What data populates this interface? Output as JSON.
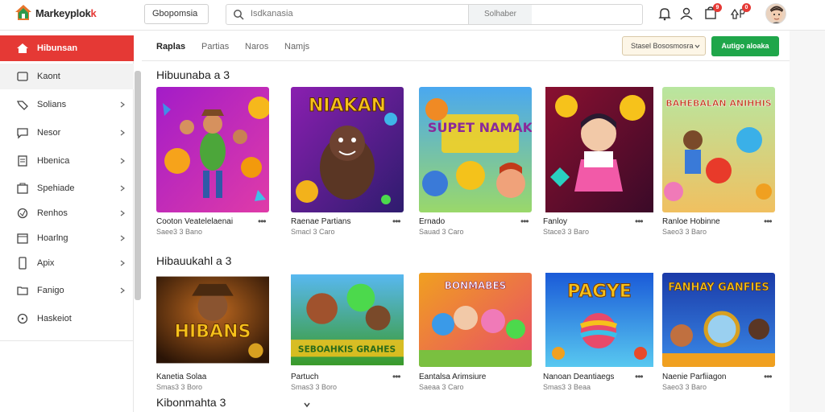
{
  "brand": {
    "name": "Markeyplok",
    "accent_suffix": "k",
    "accent_color": "#e53935"
  },
  "topbar": {
    "category_select": "Gbopomsia",
    "search": {
      "placeholder": "Isdkanasia",
      "button": "Solhaber"
    },
    "icons": [
      "bell-icon",
      "user-icon",
      "cart-icon",
      "notifications-icon"
    ],
    "badges": {
      "cart": "9",
      "notifications": "0"
    }
  },
  "sidebar": {
    "items": [
      {
        "label": "Hibunsan",
        "icon": "home-icon",
        "chevron": false
      },
      {
        "label": "Kaont",
        "icon": "clock-icon",
        "chevron": false
      },
      {
        "label": "Solians",
        "icon": "tag-icon",
        "chevron": true
      },
      {
        "label": "Nesor",
        "icon": "chat-icon",
        "chevron": true
      },
      {
        "label": "Hbenica",
        "icon": "document-icon",
        "chevron": true
      },
      {
        "label": "Spehiade",
        "icon": "box-icon",
        "chevron": true
      },
      {
        "label": "Renhos",
        "icon": "tag-icon",
        "chevron": true
      },
      {
        "label": "Hoarlng",
        "icon": "calendar-icon",
        "chevron": true
      },
      {
        "label": "Apix",
        "icon": "phone-icon",
        "chevron": true
      },
      {
        "label": "Fanigo",
        "icon": "folder-icon",
        "chevron": true
      },
      {
        "label": "Haskeiot",
        "icon": "help-icon",
        "chevron": false
      }
    ]
  },
  "tabs": [
    "Raplas",
    "Partias",
    "Naros",
    "Namjs"
  ],
  "toolbar": {
    "sort_label": "Stasel Bososmosra",
    "action_label": "Autigo aloaka"
  },
  "colors": {
    "primary": "#1fa64a",
    "active": "#e53935"
  },
  "sections": [
    {
      "title": "Hibuunaba a 3",
      "cards": [
        {
          "title": "Cooton Veatelelaenai",
          "sub": "Saee3 3 Bano",
          "thumb_text": ""
        },
        {
          "title": "Raenae Partians",
          "sub": "Smacl 3 Caro",
          "thumb_text": "NIAKAN"
        },
        {
          "title": "Ernado",
          "sub": "Sauad 3 Caro",
          "thumb_text": "SUPET NAMAK"
        },
        {
          "title": "Fanloy",
          "sub": "Stace3 3 Baro",
          "thumb_text": ""
        },
        {
          "title": "Ranloe Hobinne",
          "sub": "Saeo3 3 Baro",
          "thumb_text": "BAHEBALAN ANIHHIS"
        }
      ]
    },
    {
      "title": "Hibauukahl a 3",
      "cards": [
        {
          "title": "Kanetia Solaa",
          "sub": "Smas3 3 Boro",
          "thumb_text": "HIBANS"
        },
        {
          "title": "Partuch",
          "sub": "Smas3 3 Boro",
          "thumb_text": "SEBOAHKIS GRAHES"
        },
        {
          "title": "Eantalsa Arimsiure",
          "sub": "Saeaa 3 Caro",
          "thumb_text": "BONMABES"
        },
        {
          "title": "Nanoan Deantiaegs",
          "sub": "Smas3 3 Beaa",
          "thumb_text": "PAGYE"
        },
        {
          "title": "Naenie Parfiiagon",
          "sub": "Saeo3 3 Baro",
          "thumb_text": "FANHAY GANFIES"
        }
      ]
    },
    {
      "title": "Kibonmahta 3"
    }
  ],
  "card_menu": "•••"
}
